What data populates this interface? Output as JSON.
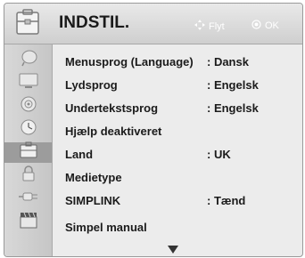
{
  "header": {
    "title": "INDSTIL.",
    "icon": "settings-toolbox-icon",
    "hints": [
      {
        "icon": "dpad-arrows-icon",
        "label": "Flyt"
      },
      {
        "icon": "ok-button-icon",
        "label": "OK"
      }
    ]
  },
  "sidebar": {
    "active_index": 5,
    "items": [
      {
        "icon": "satellite-dish-icon"
      },
      {
        "icon": "screen-icon"
      },
      {
        "icon": "speaker-icon"
      },
      {
        "icon": "clock-icon"
      },
      {
        "icon": "settings-toolbox-icon"
      },
      {
        "icon": "lock-icon"
      },
      {
        "icon": "input-cable-icon"
      },
      {
        "icon": "clapperboard-icon"
      }
    ]
  },
  "menu": {
    "items": [
      {
        "label": "Menusprog (Language)",
        "value": ": Dansk"
      },
      {
        "label": "Lydsprog",
        "value": ": Engelsk"
      },
      {
        "label": "Undertekstsprog",
        "value": ": Engelsk"
      },
      {
        "label": "Hjælp deaktiveret",
        "value": ""
      },
      {
        "label": "Land",
        "value": ": UK"
      },
      {
        "label": "Medietype",
        "value": ""
      },
      {
        "label": "SIMPLINK",
        "value": ": Tænd"
      },
      {
        "label": "Simpel manual",
        "value": ""
      }
    ],
    "more_icon": "scroll-down-arrow-icon"
  },
  "colors": {
    "osd_background": "#ececec",
    "sidebar_active": "#9c9c9c",
    "hint_text": "#ffffff"
  }
}
